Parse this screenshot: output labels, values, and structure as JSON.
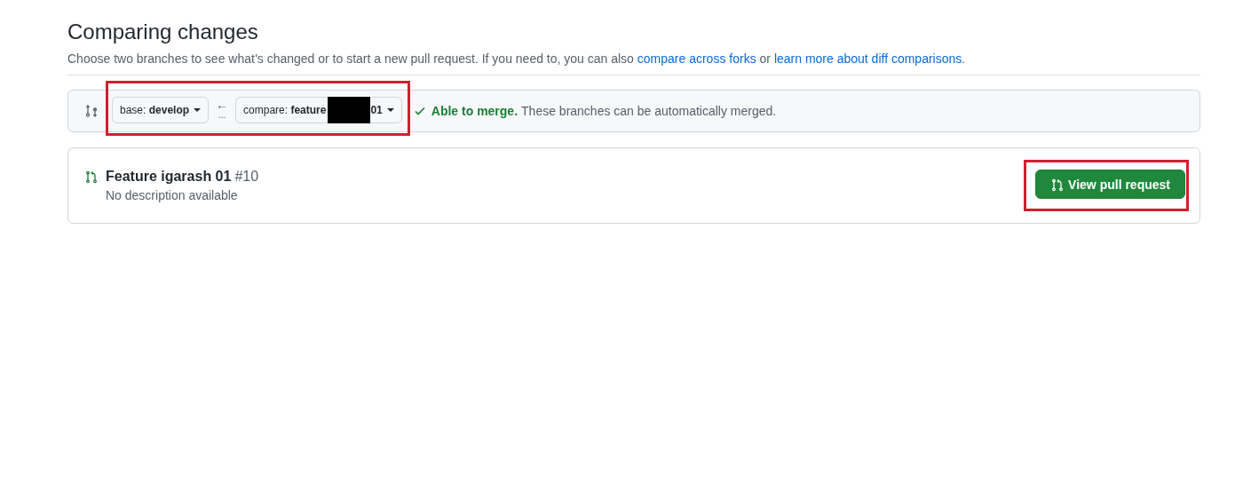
{
  "header": {
    "title": "Comparing changes",
    "description": "Choose two branches to see what’s changed or to start a new pull request. If you need to, you can also",
    "links": [
      "compare across forks",
      "learn more about diff comparisons"
    ],
    "joiner": "or",
    "end": "."
  },
  "range": {
    "base": "base: **develop**",
    "arrow": "←",
    "dots": "...",
    "compare": "compare: **feature**",
    "compare_end": "01",
    "redacted": true,
    "merge_status": "Able to merge.",
    "merge_note": "These branches can be automatically merged."
  },
  "pull_request": {
    "title": "Feature igarash 01",
    "number": "#10",
    "description": "No description available",
    "button": "View pull request"
  },
  "annotations": [
    {
      "kind": "highlight",
      "color": "#d0202e"
    },
    {
      "kind": "highlight",
      "color": "#d0202e"
    }
  ]
}
